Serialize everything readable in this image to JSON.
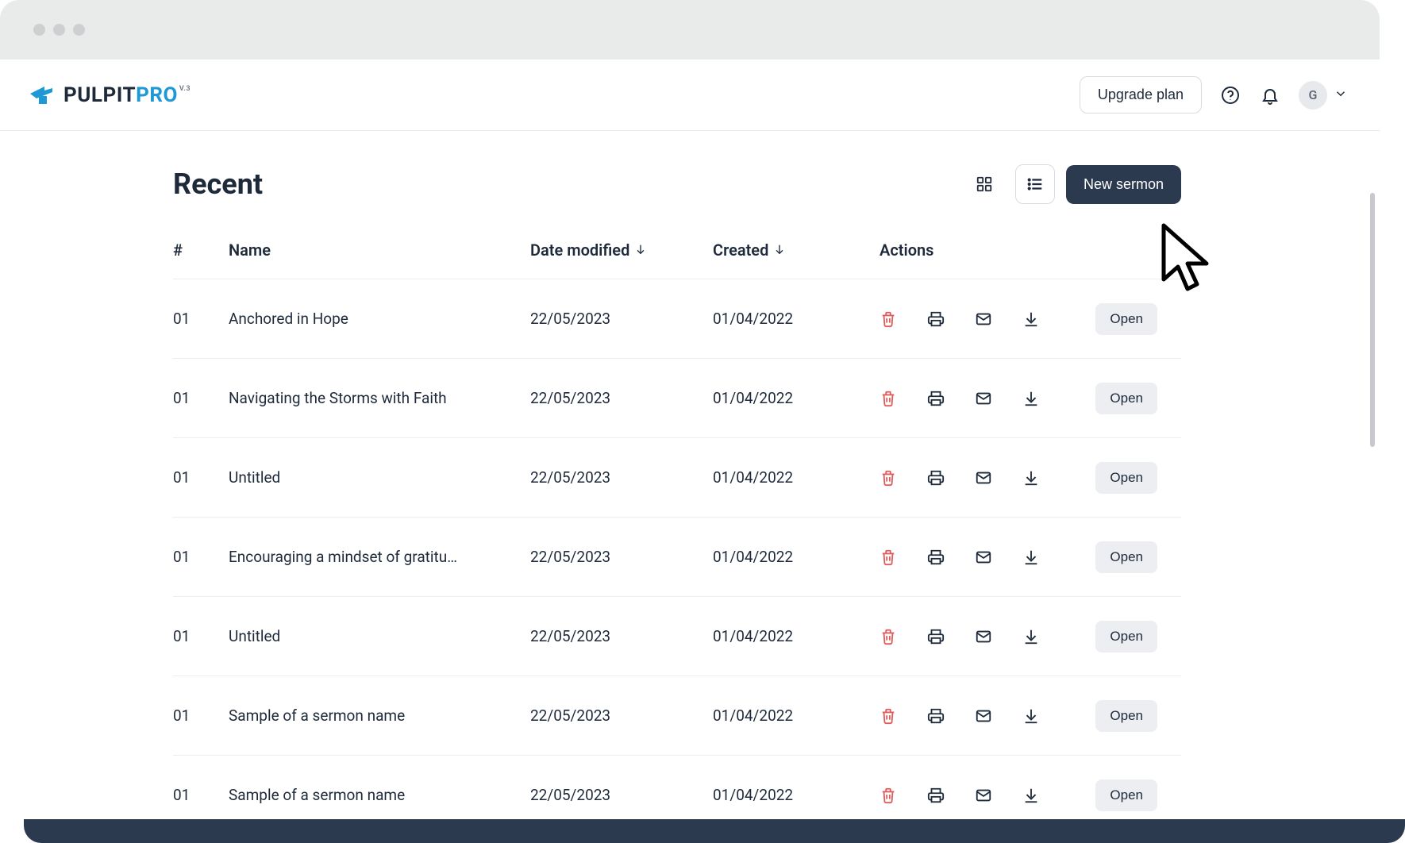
{
  "brand": {
    "word1": "PULPIT",
    "word2": "PRO",
    "version": "V.3"
  },
  "topbar": {
    "upgrade_label": "Upgrade plan",
    "avatar_initial": "G"
  },
  "page": {
    "title": "Recent",
    "new_button_label": "New sermon"
  },
  "table": {
    "headers": {
      "index": "#",
      "name": "Name",
      "date_modified": "Date modified",
      "created": "Created",
      "actions": "Actions"
    },
    "open_label": "Open",
    "rows": [
      {
        "index": "01",
        "name": "Anchored in Hope",
        "modified": "22/05/2023",
        "created": "01/04/2022"
      },
      {
        "index": "01",
        "name": "Navigating the Storms with Faith",
        "modified": "22/05/2023",
        "created": "01/04/2022"
      },
      {
        "index": "01",
        "name": "Untitled",
        "modified": "22/05/2023",
        "created": "01/04/2022"
      },
      {
        "index": "01",
        "name": "Encouraging a mindset of gratitu…",
        "modified": "22/05/2023",
        "created": "01/04/2022"
      },
      {
        "index": "01",
        "name": "Untitled",
        "modified": "22/05/2023",
        "created": "01/04/2022"
      },
      {
        "index": "01",
        "name": "Sample of a sermon name",
        "modified": "22/05/2023",
        "created": "01/04/2022"
      },
      {
        "index": "01",
        "name": "Sample of a sermon name",
        "modified": "22/05/2023",
        "created": "01/04/2022"
      }
    ]
  }
}
